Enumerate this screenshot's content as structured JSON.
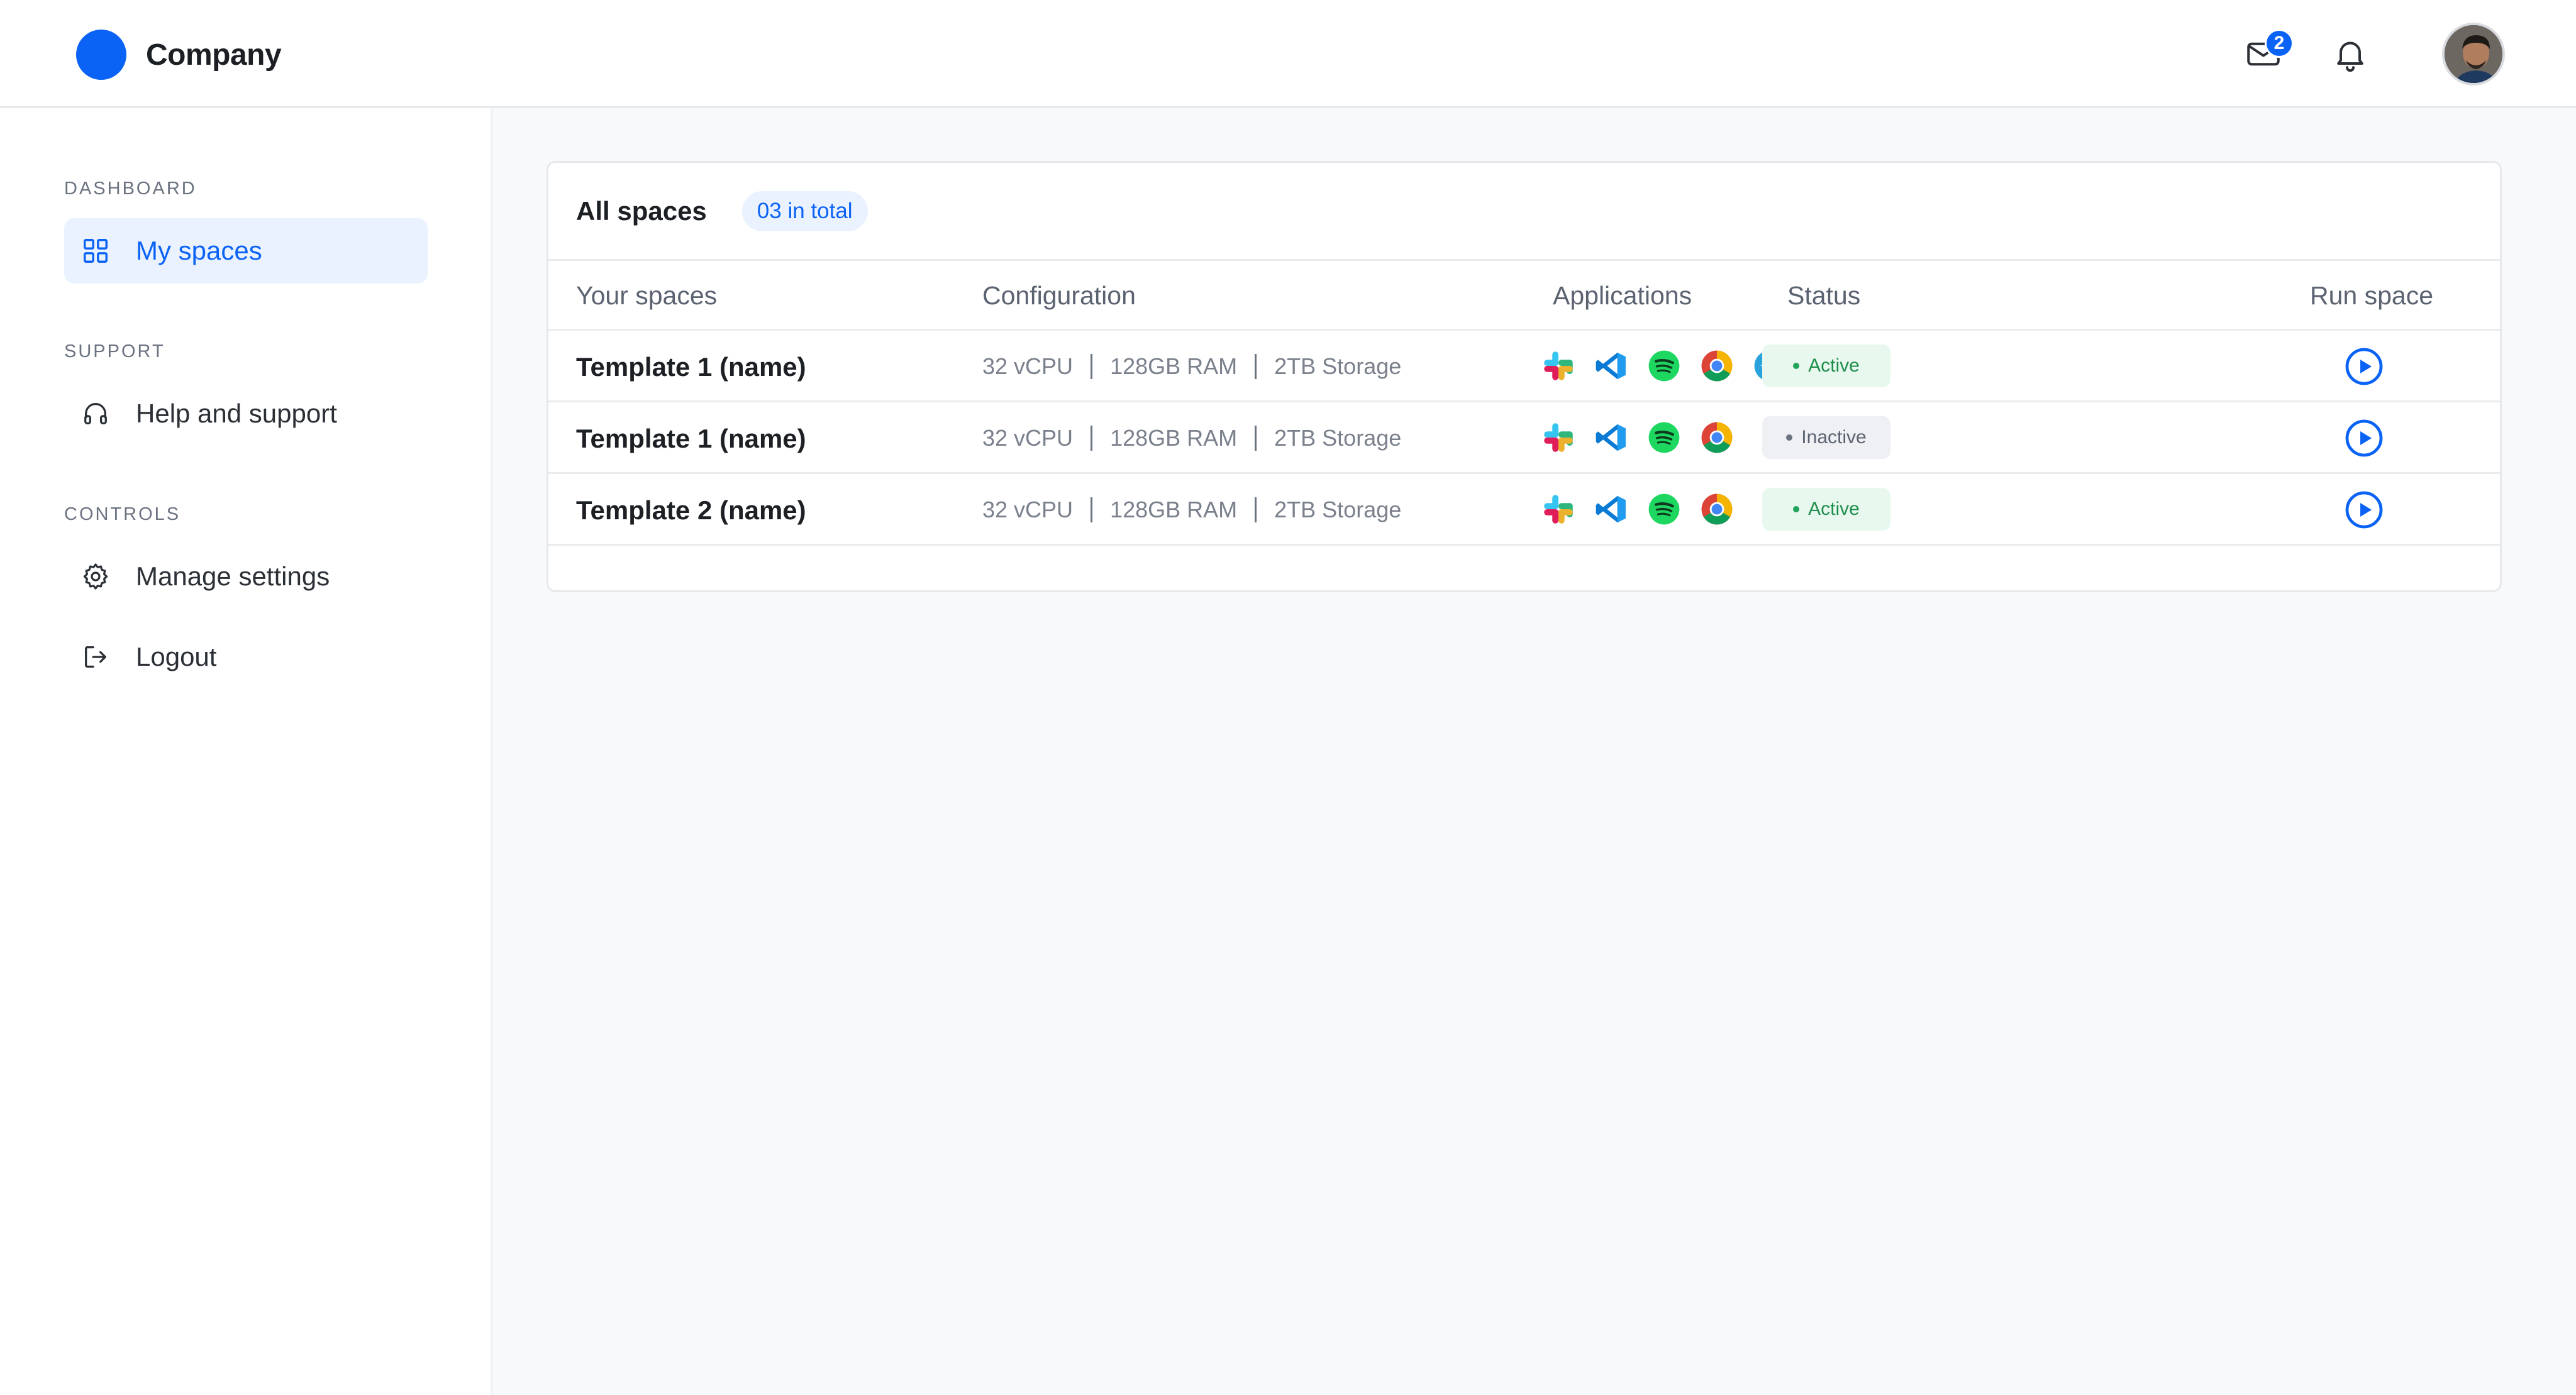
{
  "header": {
    "brand_name": "Company",
    "mail_count": "2",
    "brand_color": "#0b63f6",
    "icons": [
      "mail-icon",
      "bell-icon"
    ]
  },
  "sidebar": {
    "sections": [
      {
        "label": "DASHBOARD",
        "items": [
          {
            "label": "My spaces",
            "icon": "grid-icon",
            "active": true
          }
        ]
      },
      {
        "label": "SUPPORT",
        "items": [
          {
            "label": "Help and support",
            "icon": "headphones-icon"
          }
        ]
      },
      {
        "label": "CONTROLS",
        "items": [
          {
            "label": "Manage settings",
            "icon": "gear-icon"
          },
          {
            "label": "Logout",
            "icon": "logout-icon"
          }
        ]
      }
    ]
  },
  "main": {
    "title": "All spaces",
    "total": "03 in total",
    "columns": [
      "Your spaces",
      "Configuration",
      "Applications",
      "Status",
      "Run space"
    ],
    "rows": [
      {
        "name": "Template 1 (name)",
        "cpu": "32 vCPU",
        "ram": "128GB RAM",
        "storage": "2TB Storage",
        "apps": [
          "slack-icon",
          "vscode-icon",
          "spotify-icon",
          "chrome-icon",
          "telegram-icon"
        ],
        "status": "Active"
      },
      {
        "name": "Template 1 (name)",
        "cpu": "32 vCPU",
        "ram": "128GB RAM",
        "storage": "2TB Storage",
        "apps": [
          "slack-icon",
          "vscode-icon",
          "spotify-icon",
          "chrome-icon"
        ],
        "status": "Inactive"
      },
      {
        "name": "Template 2 (name)",
        "cpu": "32 vCPU",
        "ram": "128GB RAM",
        "storage": "2TB Storage",
        "apps": [
          "slack-icon",
          "vscode-icon",
          "spotify-icon",
          "chrome-icon"
        ],
        "status": "Active"
      }
    ]
  },
  "colors": {
    "accent": "#0b63f6",
    "active_bg": "#e8f8ee",
    "active_text": "#1e8e4c",
    "inactive_bg": "#eef0f3"
  }
}
